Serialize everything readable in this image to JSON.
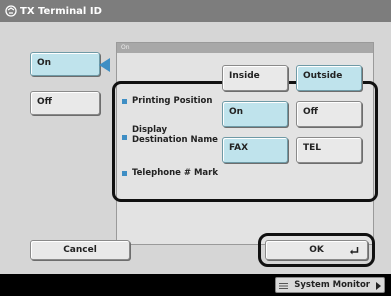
{
  "window": {
    "title": "TX Terminal ID"
  },
  "side_options": [
    {
      "label": "On",
      "selected": true
    },
    {
      "label": "Off",
      "selected": false
    }
  ],
  "panel": {
    "header": "On"
  },
  "settings": [
    {
      "label": "Printing Position",
      "options": [
        "Inside",
        "Outside"
      ],
      "selected": "Outside"
    },
    {
      "label": "Display Destination Name",
      "options": [
        "On",
        "Off"
      ],
      "selected": "On"
    },
    {
      "label": "Telephone # Mark",
      "options": [
        "FAX",
        "TEL"
      ],
      "selected": "FAX"
    }
  ],
  "actions": {
    "cancel": "Cancel",
    "ok": "OK"
  },
  "footer": {
    "system_monitor": "System Monitor"
  },
  "colors": {
    "title_bar": "#7d7d7d",
    "selected_button": "#bfe3ec",
    "accent_blue": "#3e8ec4",
    "background": "#d6d6d6"
  },
  "icons": {
    "title": "fax-settings-icon",
    "ok": "enter-icon"
  }
}
